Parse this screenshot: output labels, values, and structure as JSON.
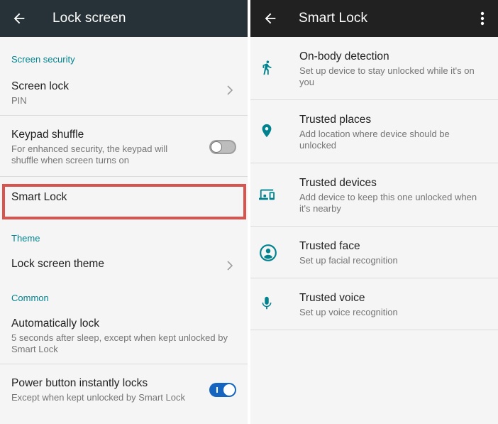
{
  "left": {
    "title": "Lock screen",
    "sections": {
      "security": "Screen security",
      "theme": "Theme",
      "common": "Common"
    },
    "items": {
      "screen_lock": {
        "title": "Screen lock",
        "subtitle": "PIN"
      },
      "keypad_shuffle": {
        "title": "Keypad shuffle",
        "subtitle": "For enhanced security, the keypad will shuffle when screen turns on",
        "enabled": false
      },
      "smart_lock": {
        "title": "Smart Lock"
      },
      "lock_screen_theme": {
        "title": "Lock screen theme"
      },
      "auto_lock": {
        "title": "Automatically lock",
        "subtitle": "5 seconds after sleep, except when kept unlocked by Smart Lock"
      },
      "power_button": {
        "title": "Power button instantly locks",
        "subtitle": "Except when kept unlocked by Smart Lock",
        "enabled": true
      }
    }
  },
  "right": {
    "title": "Smart Lock",
    "items": [
      {
        "title": "On-body detection",
        "subtitle": "Set up device to stay unlocked while it's on you",
        "icon": "walking-person-icon"
      },
      {
        "title": "Trusted places",
        "subtitle": "Add location where device should be unlocked",
        "icon": "location-pin-icon"
      },
      {
        "title": "Trusted devices",
        "subtitle": "Add device to keep this one unlocked when it's nearby",
        "icon": "devices-icon"
      },
      {
        "title": "Trusted face",
        "subtitle": "Set up facial recognition",
        "icon": "face-icon"
      },
      {
        "title": "Trusted voice",
        "subtitle": "Set up voice recognition",
        "icon": "microphone-icon"
      }
    ]
  },
  "colors": {
    "accent": "#00838f",
    "left_toolbar": "#263238",
    "right_toolbar": "#212121",
    "highlight": "#d9534f",
    "toggle_on": "#1565c0"
  }
}
